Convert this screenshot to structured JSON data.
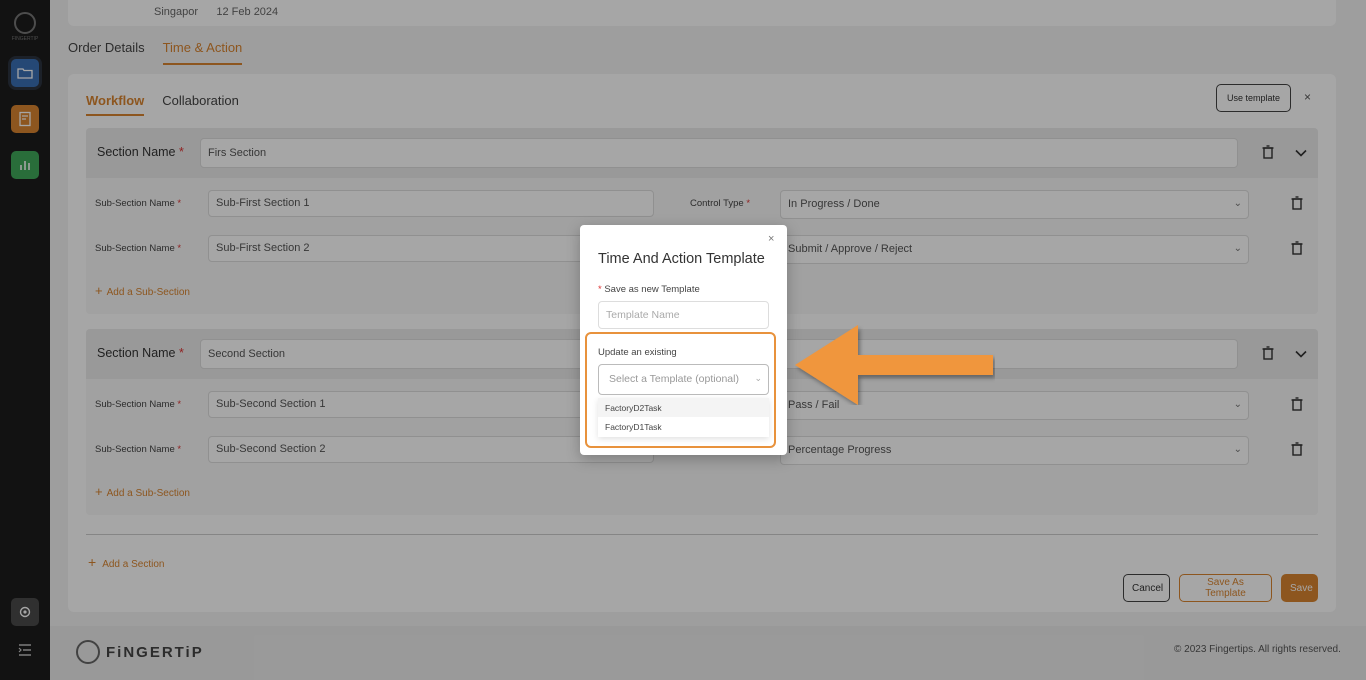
{
  "rail": {
    "logo_text": "FINGERTIP"
  },
  "top": {
    "location": "Singapor",
    "date": "12 Feb 2024"
  },
  "page_tabs": [
    {
      "label": "Order Details"
    },
    {
      "label": "Time & Action"
    }
  ],
  "sub_tabs": [
    {
      "label": "Workflow"
    },
    {
      "label": "Collaboration"
    }
  ],
  "use_template_label": "Use template",
  "close_glyph": "×",
  "section_label": "Section Name",
  "required_mark": "*",
  "sections": [
    {
      "name": "Firs Section",
      "rows": [
        {
          "label": "Sub-Section Name",
          "value": "Sub-First Section 1",
          "control_label": "Control Type",
          "control": "In Progress / Done"
        },
        {
          "label": "Sub-Section Name",
          "value": "Sub-First Section 2",
          "control_label": "",
          "control": "Submit / Approve / Reject"
        }
      ],
      "add_sub_label": "Add a Sub-Section"
    },
    {
      "name": "Second Section",
      "rows": [
        {
          "label": "Sub-Section Name",
          "value": "Sub-Second Section 1",
          "control_label": "",
          "control": "Pass / Fail"
        },
        {
          "label": "Sub-Section Name",
          "value": "Sub-Second Section 2",
          "control_label": "",
          "control": "Percentage Progress"
        }
      ],
      "add_sub_label": "Add a Sub-Section"
    }
  ],
  "add_section_label": "Add a Section",
  "buttons": {
    "cancel": "Cancel",
    "save_as_template": "Save As Template",
    "save": "Save"
  },
  "footer": {
    "brand": "FiNGERTiP",
    "copyright": "© 2023 Fingertips. All rights reserved."
  },
  "modal": {
    "close_glyph": "×",
    "title": "Time And Action Template",
    "new_label": "Save as new Template",
    "name_placeholder": "Template Name",
    "existing_label": "Update an existing",
    "select_placeholder": "Select a Template (optional)",
    "options": [
      "FactoryD2Task",
      "FactoryD1Task"
    ]
  },
  "colors": {
    "accent": "#d98530",
    "highlight": "#e8923c"
  }
}
